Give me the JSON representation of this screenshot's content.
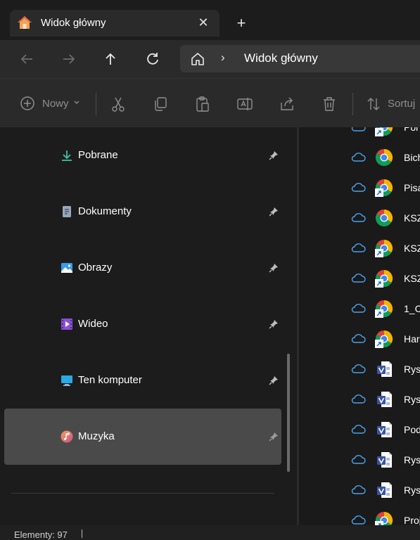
{
  "window": {
    "tab_title": "Widok główny",
    "new_tab_symbol": "+",
    "close_symbol": "✕"
  },
  "address": {
    "separator": "›",
    "location": "Widok główny"
  },
  "commands": {
    "new_label": "Nowy",
    "sort_label": "Sortuj"
  },
  "sidebar": {
    "items": [
      {
        "label": "Pobrane",
        "icon": "download-icon",
        "color": "#3fc3a5"
      },
      {
        "label": "Dokumenty",
        "icon": "document-icon",
        "color": "#9aa7bb"
      },
      {
        "label": "Obrazy",
        "icon": "pictures-icon",
        "color": "#3a9ce8"
      },
      {
        "label": "Wideo",
        "icon": "video-icon",
        "color": "#8b4fd6"
      },
      {
        "label": "Ten komputer",
        "icon": "computer-icon",
        "color": "#29a9e6"
      },
      {
        "label": "Muzyka",
        "icon": "music-icon",
        "color": "#e07a6a"
      }
    ],
    "selected_index": 5
  },
  "files": [
    {
      "name": "Pol",
      "icon": "chrome-shortcut-icon"
    },
    {
      "name": "Bich",
      "icon": "chrome-icon"
    },
    {
      "name": "Pisa",
      "icon": "chrome-shortcut-icon"
    },
    {
      "name": "KSZ",
      "icon": "chrome-icon"
    },
    {
      "name": "KSZ",
      "icon": "chrome-shortcut-icon"
    },
    {
      "name": "KSZ",
      "icon": "chrome-shortcut-icon"
    },
    {
      "name": "1_C",
      "icon": "chrome-shortcut-icon"
    },
    {
      "name": "Har",
      "icon": "chrome-shortcut-icon"
    },
    {
      "name": "Rys",
      "icon": "visio-icon"
    },
    {
      "name": "Rys",
      "icon": "visio-icon"
    },
    {
      "name": "Pod",
      "icon": "visio-icon"
    },
    {
      "name": "Rys",
      "icon": "visio-icon"
    },
    {
      "name": "Rys",
      "icon": "visio-icon"
    },
    {
      "name": "Proj",
      "icon": "chrome-shortcut-icon"
    }
  ],
  "status": {
    "items_text": "Elementy: 97"
  },
  "colors": {
    "accent_cloud": "#4aa3f0",
    "selected_bg": "#4a4a4a"
  }
}
